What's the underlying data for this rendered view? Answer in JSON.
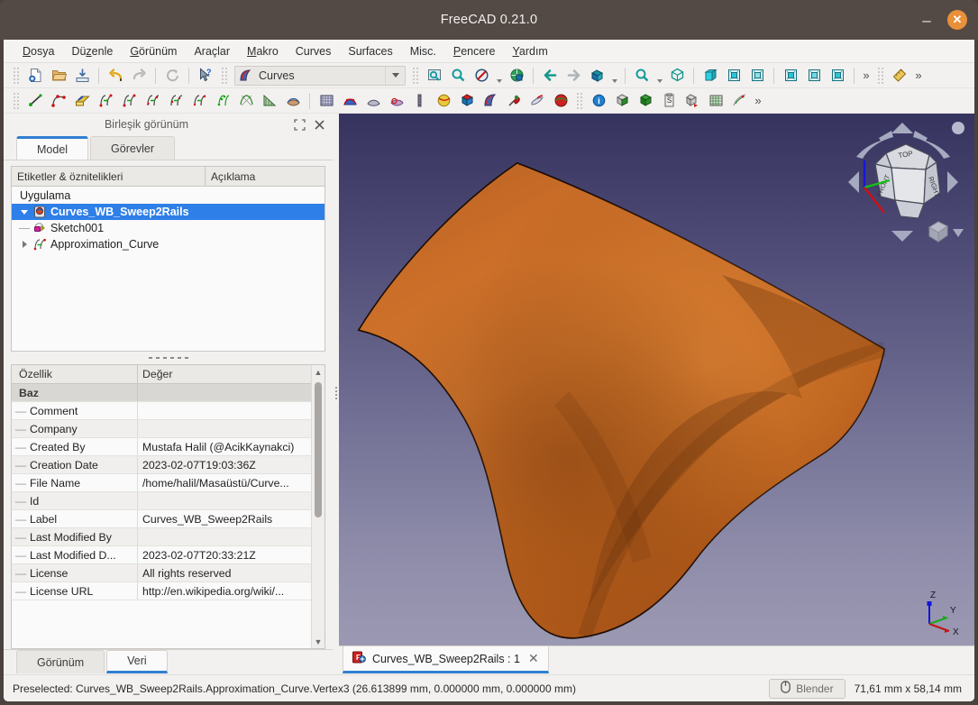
{
  "window": {
    "title": "FreeCAD 0.21.0",
    "minimize_label": "–",
    "close_label": "✕",
    "titlebar_color": "#534a45",
    "close_color": "#e8903a"
  },
  "menubar": {
    "items": [
      {
        "label": "Dosya",
        "mnemonic": "D"
      },
      {
        "label": "Düzenle",
        "mnemonic": "z"
      },
      {
        "label": "Görünüm",
        "mnemonic": "G"
      },
      {
        "label": "Araçlar",
        "mnemonic": ""
      },
      {
        "label": "Makro",
        "mnemonic": "M"
      },
      {
        "label": "Curves",
        "mnemonic": ""
      },
      {
        "label": "Surfaces",
        "mnemonic": ""
      },
      {
        "label": "Misc.",
        "mnemonic": ""
      },
      {
        "label": "Pencere",
        "mnemonic": "P"
      },
      {
        "label": "Yardım",
        "mnemonic": "Y"
      }
    ]
  },
  "toolbar": {
    "workbench_selector": {
      "value": "Curves",
      "icon": "curves-workbench-icon"
    },
    "row1_icons": [
      "new-document-icon",
      "open-document-icon",
      "save-document-icon",
      "undo-icon",
      "redo-icon",
      "refresh-icon",
      "whats-this-icon"
    ],
    "row1_view_icons": [
      "fit-all-icon",
      "zoom-fit-selection-icon",
      "draw-style-icon",
      "std-views-icon",
      "back-icon",
      "forward-icon",
      "freeze-view-icon",
      "zoom-in-icon",
      "axonometric-icon",
      "front-view-icon",
      "top-view-icon",
      "right-view-icon",
      "rear-view-icon",
      "bottom-view-icon",
      "left-view-icon",
      "measure-icon"
    ],
    "overflow_label": "»",
    "row2_icons": [
      "line-icon",
      "bspline-icon",
      "extract-icon",
      "join-curve-icon",
      "split-curve-icon",
      "discretize-icon",
      "approximate-icon",
      "interpolate-icon",
      "parametric-comb-icon",
      "zebra-icon",
      "isocurve-icon",
      "blend-surface-icon",
      "flatten-face-icon",
      "gordon-surface-icon",
      "sweep2rails-icon",
      "pipeshell-icon",
      "profile-support-icon",
      "sublink-icon",
      "map-sketch-icon",
      "sphere-icon",
      "solid-icon",
      "curves-icon",
      "pin-icon",
      "paste-icon",
      "segment-surface-icon",
      "info-icon",
      "box-element-icon",
      "green-box-icon",
      "clipboard-icon",
      "export-box-icon",
      "grid-icon",
      "mesh-icon"
    ]
  },
  "left_panel": {
    "header": {
      "title": "Birleşik görünüm",
      "float_icon": "expand-icon",
      "close_icon": "close-icon"
    },
    "tabs": [
      {
        "label": "Model",
        "active": true
      },
      {
        "label": "Görevler",
        "active": false
      }
    ],
    "tree": {
      "columns": [
        "Etiketler & öznitelikleri",
        "Açıklama"
      ],
      "app_label": "Uygulama",
      "nodes": [
        {
          "label": "Curves_WB_Sweep2Rails",
          "icon": "document-icon",
          "selected": true,
          "expanded": true,
          "depth": 0
        },
        {
          "label": "Sketch001",
          "icon": "sketch-icon",
          "selected": false,
          "expanded": null,
          "depth": 1
        },
        {
          "label": "Approximation_Curve",
          "icon": "approx-curve-icon",
          "selected": false,
          "expanded": false,
          "depth": 1
        }
      ]
    },
    "properties": {
      "columns": [
        "Özellik",
        "Değer"
      ],
      "groups": [
        {
          "name": "Baz",
          "rows": [
            {
              "name": "Comment",
              "value": ""
            },
            {
              "name": "Company",
              "value": ""
            },
            {
              "name": "Created By",
              "value": "Mustafa Halil (@AcikKaynakci)"
            },
            {
              "name": "Creation Date",
              "value": "2023-02-07T19:03:36Z"
            },
            {
              "name": "File Name",
              "value": "/home/halil/Masaüstü/Curve..."
            },
            {
              "name": "Id",
              "value": ""
            },
            {
              "name": "Label",
              "value": "Curves_WB_Sweep2Rails"
            },
            {
              "name": "Last Modified By",
              "value": ""
            },
            {
              "name": "Last Modified D...",
              "value": "2023-02-07T20:33:21Z"
            },
            {
              "name": "License",
              "value": "All rights reserved"
            },
            {
              "name": "License URL",
              "value": "http://en.wikipedia.org/wiki/..."
            }
          ]
        }
      ],
      "scrollbar": {
        "up_icon": "chevron-up-icon",
        "down_icon": "chevron-down-icon"
      }
    },
    "bottom_tabs": [
      {
        "label": "Görünüm",
        "active": false
      },
      {
        "label": "Veri",
        "active": true
      }
    ]
  },
  "view3d": {
    "background_top": "#36335f",
    "background_bottom": "#9b99b2",
    "surface_color": "#cd6f2a",
    "navcube": {
      "faces": {
        "top": "TOP",
        "front": "FRONT",
        "right": "RIGHT"
      },
      "menu_icon": "navcube-menu-icon"
    },
    "axis_labels": {
      "x": "X",
      "y": "Y",
      "z": "Z"
    },
    "axis_colors": {
      "x": "#cc0000",
      "y": "#00b000",
      "z": "#0000cc"
    }
  },
  "document_tabs": [
    {
      "label": "Curves_WB_Sweep2Rails : 1",
      "icon": "freecad-doc-icon",
      "close_label": "✕",
      "active": true
    }
  ],
  "statusbar": {
    "message": "Preselected: Curves_WB_Sweep2Rails.Approximation_Curve.Vertex3 (26.613899 mm, 0.000000 mm, 0.000000 mm)",
    "navigation_button": {
      "label": "Blender",
      "icon": "mouse-icon"
    },
    "dimensions": "71,61 mm x 58,14 mm"
  }
}
